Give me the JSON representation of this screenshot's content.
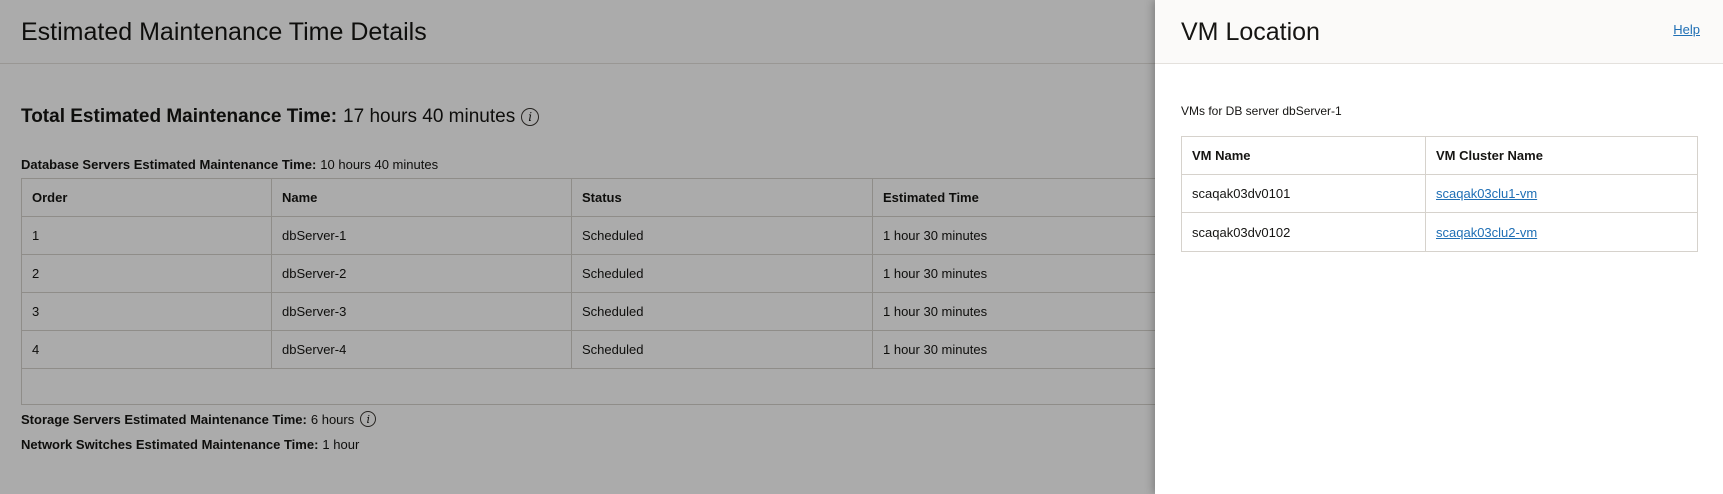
{
  "page": {
    "title": "Estimated Maintenance Time Details",
    "total_label": "Total Estimated Maintenance Time:",
    "total_value": "17 hours 40 minutes",
    "info_icon": "info-icon",
    "db_label": "Database Servers Estimated Maintenance Time:",
    "db_value": "10 hours 40 minutes",
    "storage_label": "Storage Servers Estimated Maintenance Time:",
    "storage_value": "6 hours",
    "network_label": "Network Switches Estimated Maintenance Time:",
    "network_value": "1 hour"
  },
  "servers_table": {
    "columns": [
      "Order",
      "Name",
      "Status",
      "Estimated Time"
    ],
    "rows": [
      {
        "order": "1",
        "name": "dbServer-1",
        "status": "Scheduled",
        "time": "1 hour 30 minutes"
      },
      {
        "order": "2",
        "name": "dbServer-2",
        "status": "Scheduled",
        "time": "1 hour 30 minutes"
      },
      {
        "order": "3",
        "name": "dbServer-3",
        "status": "Scheduled",
        "time": "1 hour 30 minutes"
      },
      {
        "order": "4",
        "name": "dbServer-4",
        "status": "Scheduled",
        "time": "1 hour 30 minutes"
      }
    ]
  },
  "drawer": {
    "title": "VM Location",
    "help": "Help",
    "subtitle": "VMs for DB server dbServer-1",
    "columns": [
      "VM Name",
      "VM Cluster Name"
    ],
    "rows": [
      {
        "vm": "scaqak03dv0101",
        "cluster": "scaqak03clu1-vm"
      },
      {
        "vm": "scaqak03dv0102",
        "cluster": "scaqak03clu2-vm"
      }
    ]
  },
  "colors": {
    "link": "#1f6fb5",
    "overlay": "rgba(0,0,0,0.33)"
  }
}
